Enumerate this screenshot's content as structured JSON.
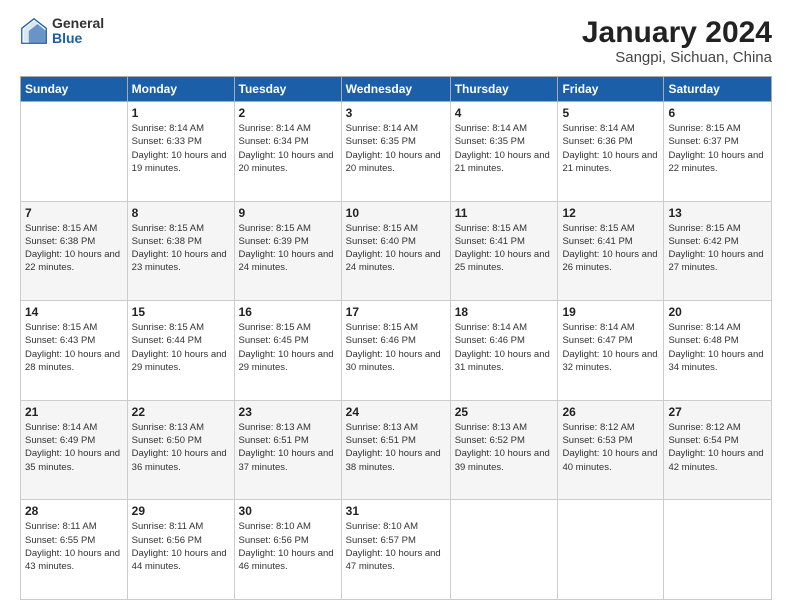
{
  "header": {
    "logo_general": "General",
    "logo_blue": "Blue",
    "title": "January 2024",
    "subtitle": "Sangpi, Sichuan, China"
  },
  "days_of_week": [
    "Sunday",
    "Monday",
    "Tuesday",
    "Wednesday",
    "Thursday",
    "Friday",
    "Saturday"
  ],
  "weeks": [
    [
      {
        "day": "",
        "sunrise": "",
        "sunset": "",
        "daylight": "",
        "empty": true
      },
      {
        "day": "1",
        "sunrise": "Sunrise: 8:14 AM",
        "sunset": "Sunset: 6:33 PM",
        "daylight": "Daylight: 10 hours and 19 minutes."
      },
      {
        "day": "2",
        "sunrise": "Sunrise: 8:14 AM",
        "sunset": "Sunset: 6:34 PM",
        "daylight": "Daylight: 10 hours and 20 minutes."
      },
      {
        "day": "3",
        "sunrise": "Sunrise: 8:14 AM",
        "sunset": "Sunset: 6:35 PM",
        "daylight": "Daylight: 10 hours and 20 minutes."
      },
      {
        "day": "4",
        "sunrise": "Sunrise: 8:14 AM",
        "sunset": "Sunset: 6:35 PM",
        "daylight": "Daylight: 10 hours and 21 minutes."
      },
      {
        "day": "5",
        "sunrise": "Sunrise: 8:14 AM",
        "sunset": "Sunset: 6:36 PM",
        "daylight": "Daylight: 10 hours and 21 minutes."
      },
      {
        "day": "6",
        "sunrise": "Sunrise: 8:15 AM",
        "sunset": "Sunset: 6:37 PM",
        "daylight": "Daylight: 10 hours and 22 minutes."
      }
    ],
    [
      {
        "day": "7",
        "sunrise": "Sunrise: 8:15 AM",
        "sunset": "Sunset: 6:38 PM",
        "daylight": "Daylight: 10 hours and 22 minutes."
      },
      {
        "day": "8",
        "sunrise": "Sunrise: 8:15 AM",
        "sunset": "Sunset: 6:38 PM",
        "daylight": "Daylight: 10 hours and 23 minutes."
      },
      {
        "day": "9",
        "sunrise": "Sunrise: 8:15 AM",
        "sunset": "Sunset: 6:39 PM",
        "daylight": "Daylight: 10 hours and 24 minutes."
      },
      {
        "day": "10",
        "sunrise": "Sunrise: 8:15 AM",
        "sunset": "Sunset: 6:40 PM",
        "daylight": "Daylight: 10 hours and 24 minutes."
      },
      {
        "day": "11",
        "sunrise": "Sunrise: 8:15 AM",
        "sunset": "Sunset: 6:41 PM",
        "daylight": "Daylight: 10 hours and 25 minutes."
      },
      {
        "day": "12",
        "sunrise": "Sunrise: 8:15 AM",
        "sunset": "Sunset: 6:41 PM",
        "daylight": "Daylight: 10 hours and 26 minutes."
      },
      {
        "day": "13",
        "sunrise": "Sunrise: 8:15 AM",
        "sunset": "Sunset: 6:42 PM",
        "daylight": "Daylight: 10 hours and 27 minutes."
      }
    ],
    [
      {
        "day": "14",
        "sunrise": "Sunrise: 8:15 AM",
        "sunset": "Sunset: 6:43 PM",
        "daylight": "Daylight: 10 hours and 28 minutes."
      },
      {
        "day": "15",
        "sunrise": "Sunrise: 8:15 AM",
        "sunset": "Sunset: 6:44 PM",
        "daylight": "Daylight: 10 hours and 29 minutes."
      },
      {
        "day": "16",
        "sunrise": "Sunrise: 8:15 AM",
        "sunset": "Sunset: 6:45 PM",
        "daylight": "Daylight: 10 hours and 29 minutes."
      },
      {
        "day": "17",
        "sunrise": "Sunrise: 8:15 AM",
        "sunset": "Sunset: 6:46 PM",
        "daylight": "Daylight: 10 hours and 30 minutes."
      },
      {
        "day": "18",
        "sunrise": "Sunrise: 8:14 AM",
        "sunset": "Sunset: 6:46 PM",
        "daylight": "Daylight: 10 hours and 31 minutes."
      },
      {
        "day": "19",
        "sunrise": "Sunrise: 8:14 AM",
        "sunset": "Sunset: 6:47 PM",
        "daylight": "Daylight: 10 hours and 32 minutes."
      },
      {
        "day": "20",
        "sunrise": "Sunrise: 8:14 AM",
        "sunset": "Sunset: 6:48 PM",
        "daylight": "Daylight: 10 hours and 34 minutes."
      }
    ],
    [
      {
        "day": "21",
        "sunrise": "Sunrise: 8:14 AM",
        "sunset": "Sunset: 6:49 PM",
        "daylight": "Daylight: 10 hours and 35 minutes."
      },
      {
        "day": "22",
        "sunrise": "Sunrise: 8:13 AM",
        "sunset": "Sunset: 6:50 PM",
        "daylight": "Daylight: 10 hours and 36 minutes."
      },
      {
        "day": "23",
        "sunrise": "Sunrise: 8:13 AM",
        "sunset": "Sunset: 6:51 PM",
        "daylight": "Daylight: 10 hours and 37 minutes."
      },
      {
        "day": "24",
        "sunrise": "Sunrise: 8:13 AM",
        "sunset": "Sunset: 6:51 PM",
        "daylight": "Daylight: 10 hours and 38 minutes."
      },
      {
        "day": "25",
        "sunrise": "Sunrise: 8:13 AM",
        "sunset": "Sunset: 6:52 PM",
        "daylight": "Daylight: 10 hours and 39 minutes."
      },
      {
        "day": "26",
        "sunrise": "Sunrise: 8:12 AM",
        "sunset": "Sunset: 6:53 PM",
        "daylight": "Daylight: 10 hours and 40 minutes."
      },
      {
        "day": "27",
        "sunrise": "Sunrise: 8:12 AM",
        "sunset": "Sunset: 6:54 PM",
        "daylight": "Daylight: 10 hours and 42 minutes."
      }
    ],
    [
      {
        "day": "28",
        "sunrise": "Sunrise: 8:11 AM",
        "sunset": "Sunset: 6:55 PM",
        "daylight": "Daylight: 10 hours and 43 minutes."
      },
      {
        "day": "29",
        "sunrise": "Sunrise: 8:11 AM",
        "sunset": "Sunset: 6:56 PM",
        "daylight": "Daylight: 10 hours and 44 minutes."
      },
      {
        "day": "30",
        "sunrise": "Sunrise: 8:10 AM",
        "sunset": "Sunset: 6:56 PM",
        "daylight": "Daylight: 10 hours and 46 minutes."
      },
      {
        "day": "31",
        "sunrise": "Sunrise: 8:10 AM",
        "sunset": "Sunset: 6:57 PM",
        "daylight": "Daylight: 10 hours and 47 minutes."
      },
      {
        "day": "",
        "sunrise": "",
        "sunset": "",
        "daylight": "",
        "empty": true
      },
      {
        "day": "",
        "sunrise": "",
        "sunset": "",
        "daylight": "",
        "empty": true
      },
      {
        "day": "",
        "sunrise": "",
        "sunset": "",
        "daylight": "",
        "empty": true
      }
    ]
  ]
}
